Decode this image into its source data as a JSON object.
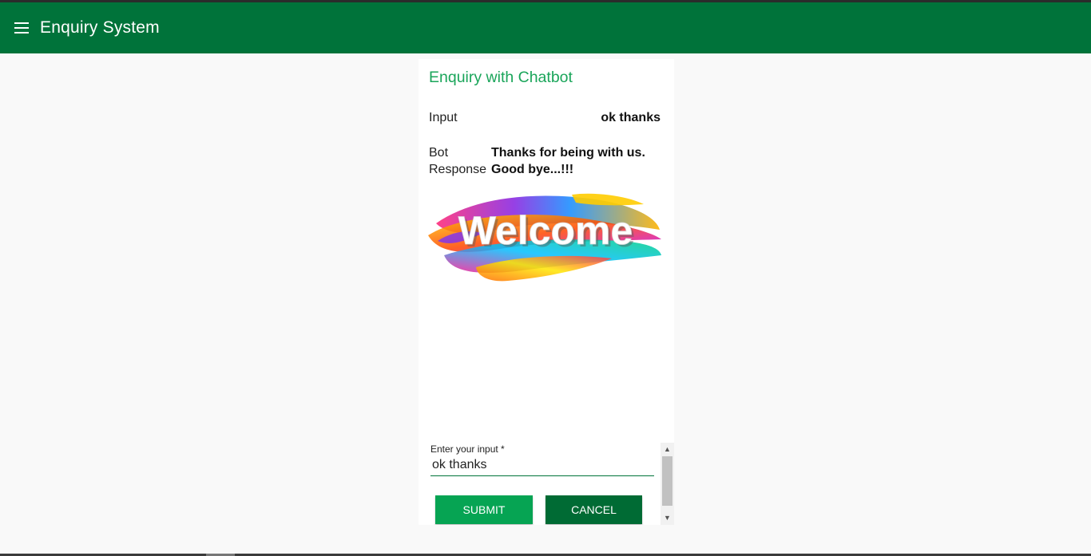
{
  "app": {
    "title": "Enquiry System"
  },
  "card": {
    "title": "Enquiry with Chatbot",
    "input_label": "Input",
    "input_value": "ok thanks",
    "bot_label_line1": "Bot",
    "bot_label_line2": "Response",
    "bot_response_line1": "Thanks for being with us.",
    "bot_response_line2": "Good bye...!!!",
    "image_text": "Welcome"
  },
  "form": {
    "label": "Enter your input *",
    "value": "ok thanks",
    "submit_label": "SUBMIT",
    "cancel_label": "CANCEL"
  },
  "colors": {
    "appbar": "#00733a",
    "title_green": "#1aa55a",
    "submit": "#06a453",
    "cancel": "#006b34"
  },
  "icons": {
    "menu": "hamburger-menu-icon"
  }
}
